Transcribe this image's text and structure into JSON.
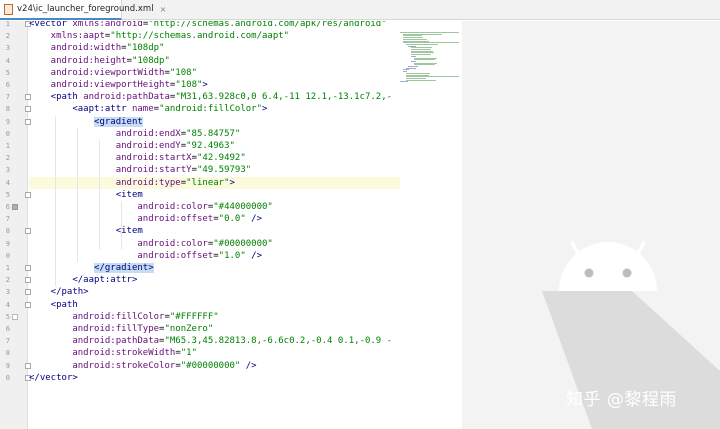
{
  "tab": {
    "label": "v24\\ic_launcher_foreground.xml",
    "close": "×"
  },
  "line_numbers": [
    "1",
    "2",
    "3",
    "4",
    "5",
    "6",
    "7",
    "8",
    "9",
    "0",
    "1",
    "2",
    "3",
    "4",
    "5",
    "6",
    "7",
    "8",
    "9",
    "0",
    "1",
    "2",
    "3",
    "4",
    "5",
    "6",
    "7",
    "8",
    "9",
    "0"
  ],
  "code": [
    [
      {
        "t": "<vector ",
        "c": "tag"
      },
      {
        "t": "xmlns:android",
        "c": "attr"
      },
      {
        "t": "=",
        "c": ""
      },
      {
        "t": "\"http://schemas.android.com/apk/res/android\"",
        "c": "val"
      }
    ],
    [
      {
        "t": "    xmlns:aapt",
        "c": "attr"
      },
      {
        "t": "=",
        "c": ""
      },
      {
        "t": "\"http://schemas.android.com/aapt\"",
        "c": "val"
      }
    ],
    [
      {
        "t": "    android:width",
        "c": "attr"
      },
      {
        "t": "=",
        "c": ""
      },
      {
        "t": "\"108dp\"",
        "c": "val"
      }
    ],
    [
      {
        "t": "    android:height",
        "c": "attr"
      },
      {
        "t": "=",
        "c": ""
      },
      {
        "t": "\"108dp\"",
        "c": "val"
      }
    ],
    [
      {
        "t": "    android:viewportWidth",
        "c": "attr"
      },
      {
        "t": "=",
        "c": ""
      },
      {
        "t": "\"108\"",
        "c": "val"
      }
    ],
    [
      {
        "t": "    android:viewportHeight",
        "c": "attr"
      },
      {
        "t": "=",
        "c": ""
      },
      {
        "t": "\"108\"",
        "c": "val"
      },
      {
        "t": ">",
        "c": "tag"
      }
    ],
    [
      {
        "t": "    <path ",
        "c": "tag"
      },
      {
        "t": "android:pathData",
        "c": "attr"
      },
      {
        "t": "=",
        "c": ""
      },
      {
        "t": "\"M31,63.928c0,0 6.4,-11 12.1,-13.1c7.2,-",
        "c": "val"
      }
    ],
    [
      {
        "t": "        <aapt:attr ",
        "c": "tag"
      },
      {
        "t": "name",
        "c": "attr"
      },
      {
        "t": "=",
        "c": ""
      },
      {
        "t": "\"android:fillColor\"",
        "c": "val"
      },
      {
        "t": ">",
        "c": "tag"
      }
    ],
    [
      {
        "t": "            ",
        "c": ""
      },
      {
        "t": "<gradient",
        "c": "sel"
      }
    ],
    [
      {
        "t": "                android:endX",
        "c": "attr"
      },
      {
        "t": "=",
        "c": ""
      },
      {
        "t": "\"85.84757\"",
        "c": "val"
      }
    ],
    [
      {
        "t": "                android:endY",
        "c": "attr"
      },
      {
        "t": "=",
        "c": ""
      },
      {
        "t": "\"92.4963\"",
        "c": "val"
      }
    ],
    [
      {
        "t": "                android:startX",
        "c": "attr"
      },
      {
        "t": "=",
        "c": ""
      },
      {
        "t": "\"42.9492\"",
        "c": "val"
      }
    ],
    [
      {
        "t": "                android:startY",
        "c": "attr"
      },
      {
        "t": "=",
        "c": ""
      },
      {
        "t": "\"49.59793\"",
        "c": "val"
      }
    ],
    [
      {
        "t": "                android:type",
        "c": "attr"
      },
      {
        "t": "=",
        "c": ""
      },
      {
        "t": "\"linear\"",
        "c": "val"
      },
      {
        "t": ">",
        "c": "tag"
      }
    ],
    [
      {
        "t": "                <item",
        "c": "tag"
      }
    ],
    [
      {
        "t": "                    android:color",
        "c": "attr"
      },
      {
        "t": "=",
        "c": ""
      },
      {
        "t": "\"#44000000\"",
        "c": "val"
      }
    ],
    [
      {
        "t": "                    android:offset",
        "c": "attr"
      },
      {
        "t": "=",
        "c": ""
      },
      {
        "t": "\"0.0\"",
        "c": "val"
      },
      {
        "t": " />",
        "c": "tag"
      }
    ],
    [
      {
        "t": "                <item",
        "c": "tag"
      }
    ],
    [
      {
        "t": "                    android:color",
        "c": "attr"
      },
      {
        "t": "=",
        "c": ""
      },
      {
        "t": "\"#00000000\"",
        "c": "val"
      }
    ],
    [
      {
        "t": "                    android:offset",
        "c": "attr"
      },
      {
        "t": "=",
        "c": ""
      },
      {
        "t": "\"1.0\"",
        "c": "val"
      },
      {
        "t": " />",
        "c": "tag"
      }
    ],
    [
      {
        "t": "            ",
        "c": ""
      },
      {
        "t": "</gradient>",
        "c": "sel"
      }
    ],
    [
      {
        "t": "        </aapt:attr>",
        "c": "tag"
      }
    ],
    [
      {
        "t": "    </path>",
        "c": "tag"
      }
    ],
    [
      {
        "t": "    <path",
        "c": "tag"
      }
    ],
    [
      {
        "t": "        android:fillColor",
        "c": "attr"
      },
      {
        "t": "=",
        "c": ""
      },
      {
        "t": "\"#FFFFFF\"",
        "c": "val"
      }
    ],
    [
      {
        "t": "        android:fillType",
        "c": "attr"
      },
      {
        "t": "=",
        "c": ""
      },
      {
        "t": "\"nonZero\"",
        "c": "val"
      }
    ],
    [
      {
        "t": "        android:pathData",
        "c": "attr"
      },
      {
        "t": "=",
        "c": ""
      },
      {
        "t": "\"M65.3,45.82813.8,-6.6c0.2,-0.4 0.1,-0.9 -",
        "c": "val"
      }
    ],
    [
      {
        "t": "        android:strokeWidth",
        "c": "attr"
      },
      {
        "t": "=",
        "c": ""
      },
      {
        "t": "\"1\"",
        "c": "val"
      }
    ],
    [
      {
        "t": "        android:strokeColor",
        "c": "attr"
      },
      {
        "t": "=",
        "c": ""
      },
      {
        "t": "\"#00000000\"",
        "c": "val"
      },
      {
        "t": " />",
        "c": "tag"
      }
    ],
    [
      {
        "t": "</vector>",
        "c": "tag"
      }
    ]
  ],
  "highlighted_line_index": 13,
  "watermark": "知乎 @黎程雨",
  "colors": {
    "tag": "#000080",
    "attribute": "#660e7a",
    "value": "#008000",
    "selection": "#c5dcf2",
    "current_line": "#fcfadd",
    "android_shadow": "#d8d8d8",
    "android_shape": "#ffffff"
  }
}
